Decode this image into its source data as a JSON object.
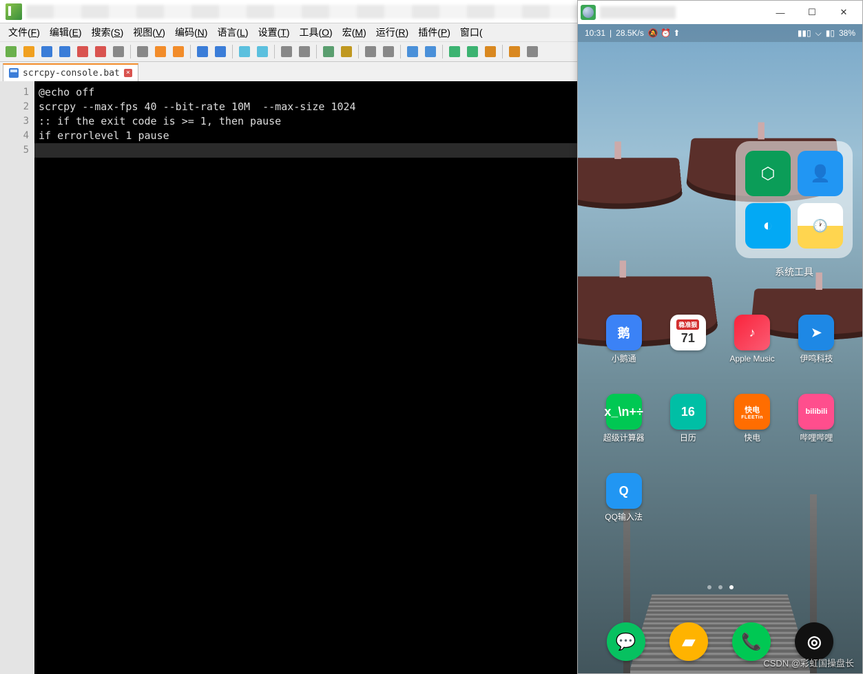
{
  "menus": [
    "文件(F)",
    "编辑(E)",
    "搜索(S)",
    "视图(V)",
    "编码(N)",
    "语言(L)",
    "设置(T)",
    "工具(O)",
    "宏(M)",
    "运行(R)",
    "插件(P)",
    "窗口("
  ],
  "tab_name": "scrcpy-console.bat",
  "code_lines": [
    "@echo off",
    "scrcpy --max-fps 40 --bit-rate 10M  --max-size 1024",
    ":: if the exit code is >= 1, then pause",
    "if errorlevel 1 pause",
    ""
  ],
  "gutter": [
    "1",
    "2",
    "3",
    "4",
    "5"
  ],
  "toolbar_icons": [
    "new",
    "open",
    "save",
    "save-all",
    "close",
    "close-all",
    "print",
    "|",
    "cut",
    "copy",
    "paste",
    "|",
    "undo",
    "redo",
    "|",
    "find",
    "replace",
    "|",
    "zoom-in",
    "zoom-out",
    "|",
    "sync",
    "bookmark",
    "|",
    "ws1",
    "ws2",
    "|",
    "indent-guide",
    "wrap",
    "|",
    "macro-rec",
    "macro-play",
    "macro-stop",
    "|",
    "folder1",
    "folder2"
  ],
  "phone": {
    "status": {
      "time": "10:31",
      "net": "28.5K/s",
      "icons": "🔕 ⏰ ⬆",
      "signal": "📶",
      "wifi": "📶",
      "batt_text": "38%",
      "batt_icon": "🔋"
    },
    "folder_label": "系统工具",
    "apps_row1": [
      {
        "label": "小鹅通",
        "bg": "#3b82f6",
        "txt": "鹅"
      },
      {
        "label": "",
        "bg": "#ffffff",
        "txt": "71",
        "sub": "稳准狠",
        "dark": true
      },
      {
        "label": "Apple Music",
        "bg": "linear-gradient(135deg,#fa233b,#fb5c74)",
        "txt": "♪"
      },
      {
        "label": "伊鸣科技",
        "bg": "#1e88e5",
        "txt": "➤"
      }
    ],
    "apps_row2": [
      {
        "label": "超级计算器",
        "bg": "#00c853",
        "txt": "x_\\n+÷"
      },
      {
        "label": "日历",
        "bg": "#00bfa5",
        "txt": "16"
      },
      {
        "label": "快电",
        "bg": "#ff6d00",
        "txt": "快电",
        "small": true,
        "sub2": "FLEETin"
      },
      {
        "label": "哔哩哔哩",
        "bg": "#ff4e8d",
        "txt": "bilibili",
        "small": true
      }
    ],
    "apps_row3": [
      {
        "label": "QQ输入法",
        "bg": "#2196f3",
        "txt": "Q"
      }
    ],
    "dock": [
      {
        "name": "wechat",
        "bg": "#07c160",
        "glyph": "💬"
      },
      {
        "name": "sms",
        "bg": "#ffb300",
        "glyph": "▰"
      },
      {
        "name": "phone",
        "bg": "#00c853",
        "glyph": "📞"
      },
      {
        "name": "camera",
        "bg": "#111",
        "glyph": "◎"
      }
    ]
  },
  "watermark": "CSDN @彩虹国操盘长"
}
